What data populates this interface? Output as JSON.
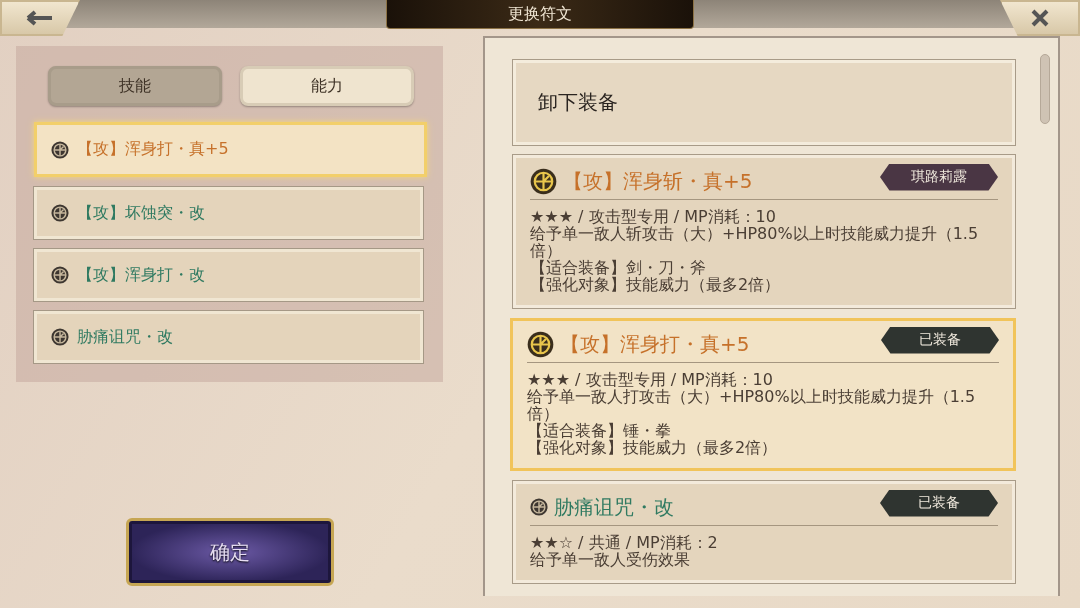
{
  "title": "更换符文",
  "tabs": [
    {
      "label": "技能",
      "selected": true
    },
    {
      "label": "能力",
      "selected": false
    }
  ],
  "runes": [
    {
      "name": "【攻】浑身打・真+5",
      "kind": "true",
      "selected": true
    },
    {
      "name": "【攻】坏蚀突・改",
      "kind": "kai",
      "selected": false
    },
    {
      "name": "【攻】浑身打・改",
      "kind": "kai",
      "selected": false
    },
    {
      "name": "胁痛诅咒・改",
      "kind": "kai",
      "selected": false
    }
  ],
  "confirm_button": "确定",
  "unequip": "卸下装备",
  "cards": [
    {
      "name": "【攻】浑身斩・真+5",
      "kind": "true",
      "selected": false,
      "badge": {
        "label": "琪路莉露",
        "kind": "owner"
      },
      "lines": [
        "★★★ / 攻击型专用 / MP消耗：10",
        "给予单一敌人斩攻击（大）+HP80%以上时技能威力提升（1.5倍）",
        "【适合装备】剑・刀・斧",
        "【强化对象】技能威力（最多2倍）"
      ]
    },
    {
      "name": "【攻】浑身打・真+5",
      "kind": "true",
      "selected": true,
      "badge": {
        "label": "已装备",
        "kind": "equipped"
      },
      "lines": [
        "★★★ / 攻击型专用 / MP消耗：10",
        "给予单一敌人打攻击（大）+HP80%以上时技能威力提升（1.5倍）",
        "【适合装备】锤・拳",
        "【强化对象】技能威力（最多2倍）"
      ]
    },
    {
      "name": "胁痛诅咒・改",
      "kind": "kai",
      "selected": false,
      "badge": {
        "label": "已装备",
        "kind": "equipped"
      },
      "lines": [
        "★★☆ / 共通 / MP消耗：2",
        "给予单一敌人受伤效果"
      ]
    }
  ]
}
